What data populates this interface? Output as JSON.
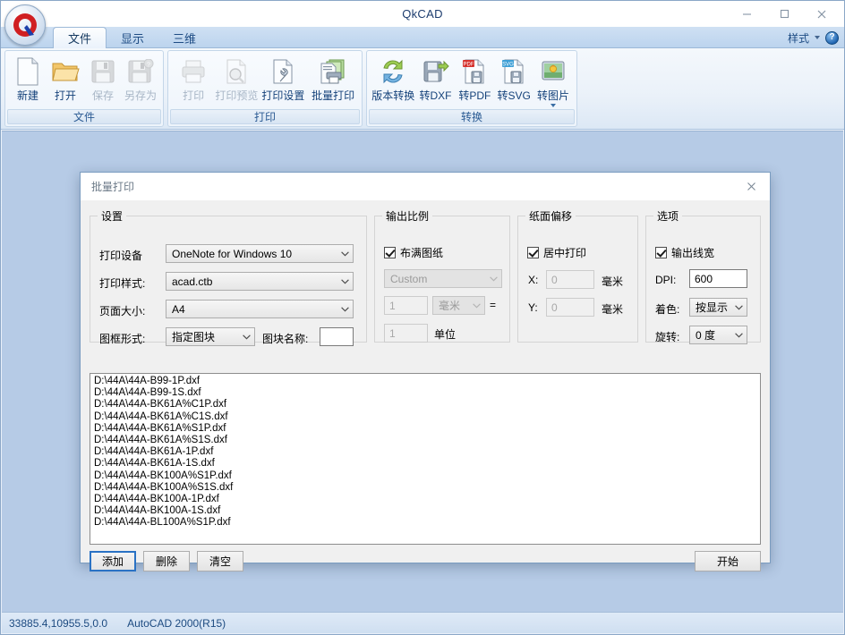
{
  "window": {
    "title": "QkCAD",
    "minimize_label": "minimize",
    "maximize_label": "maximize",
    "close_label": "close"
  },
  "ribbon": {
    "tabs": [
      {
        "label": "文件",
        "active": true
      },
      {
        "label": "显示",
        "active": false
      },
      {
        "label": "三维",
        "active": false
      }
    ],
    "style_label": "样式",
    "groups": [
      {
        "caption": "文件",
        "items": [
          {
            "label": "新建",
            "icon": "new-file-icon",
            "disabled": false
          },
          {
            "label": "打开",
            "icon": "open-folder-icon",
            "disabled": false
          },
          {
            "label": "保存",
            "icon": "save-disk-icon",
            "disabled": true
          },
          {
            "label": "另存为",
            "icon": "save-as-icon",
            "disabled": true
          }
        ]
      },
      {
        "caption": "打印",
        "items": [
          {
            "label": "打印",
            "icon": "printer-icon",
            "disabled": true
          },
          {
            "label": "打印预览",
            "icon": "print-preview-icon",
            "disabled": true
          },
          {
            "label": "打印设置",
            "icon": "print-settings-icon",
            "disabled": false
          },
          {
            "label": "批量打印",
            "icon": "batch-print-icon",
            "disabled": false
          }
        ]
      },
      {
        "caption": "转换",
        "items": [
          {
            "label": "版本转换",
            "icon": "convert-version-icon",
            "disabled": false
          },
          {
            "label": "转DXF",
            "icon": "to-dxf-icon",
            "disabled": false
          },
          {
            "label": "转PDF",
            "icon": "to-pdf-icon",
            "disabled": false
          },
          {
            "label": "转SVG",
            "icon": "to-svg-icon",
            "disabled": false
          },
          {
            "label": "转图片",
            "icon": "to-image-icon",
            "disabled": false,
            "has_caret": true
          }
        ]
      }
    ]
  },
  "dialog": {
    "title": "批量打印",
    "settings": {
      "legend": "设置",
      "device_label": "打印设备",
      "device_value": "OneNote for Windows 10",
      "style_label": "打印样式:",
      "style_value": "acad.ctb",
      "pagesize_label": "页面大小:",
      "pagesize_value": "A4",
      "frame_label": "图框形式:",
      "frame_value": "指定图块",
      "blockname_label": "图块名称:",
      "blockname_value": ""
    },
    "scale": {
      "legend": "输出比例",
      "fit_label": "布满图纸",
      "fit_checked": true,
      "preset_value": "Custom",
      "num_value": "1",
      "unit_value": "毫米",
      "equals": "=",
      "den_value": "1",
      "den_unit_label": "单位"
    },
    "offset": {
      "legend": "纸面偏移",
      "center_label": "居中打印",
      "center_checked": true,
      "x_label": "X:",
      "x_value": "0",
      "x_unit": "毫米",
      "y_label": "Y:",
      "y_value": "0",
      "y_unit": "毫米"
    },
    "options": {
      "legend": "选项",
      "lineweight_label": "输出线宽",
      "lineweight_checked": true,
      "dpi_label": "DPI:",
      "dpi_value": "600",
      "color_label": "着色:",
      "color_value": "按显示",
      "rotate_label": "旋转:",
      "rotate_value": "0 度"
    },
    "files": [
      "D:\\44A\\44A-B99-1P.dxf",
      "D:\\44A\\44A-B99-1S.dxf",
      "D:\\44A\\44A-BK61A%C1P.dxf",
      "D:\\44A\\44A-BK61A%C1S.dxf",
      "D:\\44A\\44A-BK61A%S1P.dxf",
      "D:\\44A\\44A-BK61A%S1S.dxf",
      "D:\\44A\\44A-BK61A-1P.dxf",
      "D:\\44A\\44A-BK61A-1S.dxf",
      "D:\\44A\\44A-BK100A%S1P.dxf",
      "D:\\44A\\44A-BK100A%S1S.dxf",
      "D:\\44A\\44A-BK100A-1P.dxf",
      "D:\\44A\\44A-BK100A-1S.dxf",
      "D:\\44A\\44A-BL100A%S1P.dxf"
    ],
    "buttons": {
      "add": "添加",
      "delete": "删除",
      "clear": "清空",
      "start": "开始"
    }
  },
  "statusbar": {
    "coordinates": "33885.4,10955.5,0.0",
    "version": "AutoCAD 2000(R15)"
  }
}
